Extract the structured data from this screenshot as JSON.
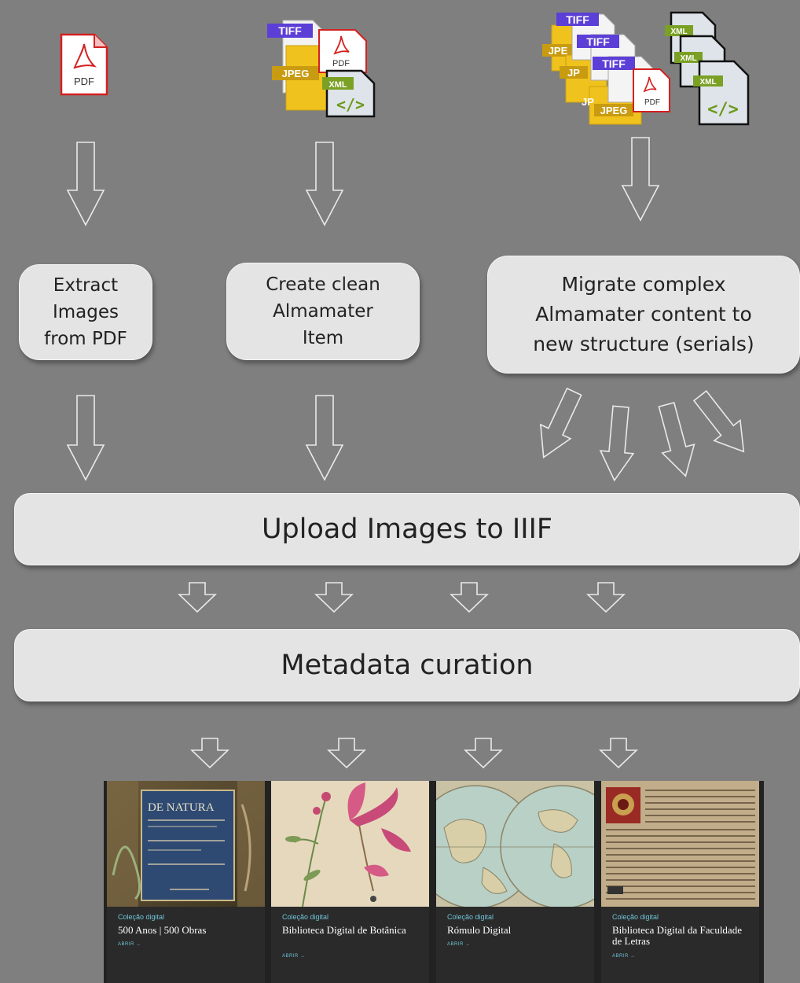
{
  "top_icons": {
    "col1": {
      "pdf": "PDF"
    },
    "col2": {
      "tiff": "TIFF",
      "jpeg": "JPEG",
      "pdf": "PDF",
      "xml": "XML",
      "code": "</>"
    },
    "col3": {
      "tiff": "TIFF",
      "jpeg": "JPEG",
      "jpeg_partial": "JPE",
      "jp_partial": "JP",
      "pdf": "PDF",
      "xml": "XML",
      "code": "</>"
    }
  },
  "steps": {
    "extract": "Extract\nImages\nfrom PDF",
    "create": "Create clean\nAlmamater\nItem",
    "migrate": "Migrate complex\nAlmamater content to\nnew structure (serials)",
    "upload": "Upload Images to IIIF",
    "curation": "Metadata curation"
  },
  "cards": [
    {
      "kicker": "Coleção digital",
      "title": "500 Anos | 500 Obras",
      "open": "ABRIR →",
      "thumb_text": "DE NATURA"
    },
    {
      "kicker": "Coleção digital",
      "title": "Biblioteca Digital de Botânica",
      "open": "ABRIR →"
    },
    {
      "kicker": "Coleção digital",
      "title": "Rómulo Digital",
      "open": "ABRIR →"
    },
    {
      "kicker": "Coleção digital",
      "title": "Biblioteca Digital da Faculdade de Letras",
      "open": "ABRIR →"
    }
  ],
  "colors": {
    "background": "#7f7f7f",
    "box": "#e4e4e4",
    "tiff": "#5b3fd6",
    "jpeg": "#e0b21b",
    "xml": "#7aa024",
    "pdf": "#e02020",
    "accent": "#6fc3d6"
  }
}
